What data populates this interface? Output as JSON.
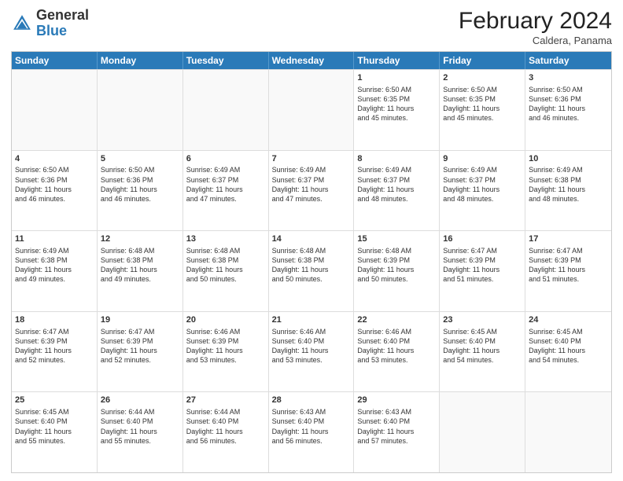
{
  "header": {
    "logo_general": "General",
    "logo_blue": "Blue",
    "month_title": "February 2024",
    "subtitle": "Caldera, Panama"
  },
  "days_of_week": [
    "Sunday",
    "Monday",
    "Tuesday",
    "Wednesday",
    "Thursday",
    "Friday",
    "Saturday"
  ],
  "weeks": [
    [
      {
        "day": "",
        "lines": [],
        "empty": true
      },
      {
        "day": "",
        "lines": [],
        "empty": true
      },
      {
        "day": "",
        "lines": [],
        "empty": true
      },
      {
        "day": "",
        "lines": [],
        "empty": true
      },
      {
        "day": "1",
        "lines": [
          "Sunrise: 6:50 AM",
          "Sunset: 6:35 PM",
          "Daylight: 11 hours",
          "and 45 minutes."
        ],
        "empty": false
      },
      {
        "day": "2",
        "lines": [
          "Sunrise: 6:50 AM",
          "Sunset: 6:35 PM",
          "Daylight: 11 hours",
          "and 45 minutes."
        ],
        "empty": false
      },
      {
        "day": "3",
        "lines": [
          "Sunrise: 6:50 AM",
          "Sunset: 6:36 PM",
          "Daylight: 11 hours",
          "and 46 minutes."
        ],
        "empty": false
      }
    ],
    [
      {
        "day": "4",
        "lines": [
          "Sunrise: 6:50 AM",
          "Sunset: 6:36 PM",
          "Daylight: 11 hours",
          "and 46 minutes."
        ],
        "empty": false
      },
      {
        "day": "5",
        "lines": [
          "Sunrise: 6:50 AM",
          "Sunset: 6:36 PM",
          "Daylight: 11 hours",
          "and 46 minutes."
        ],
        "empty": false
      },
      {
        "day": "6",
        "lines": [
          "Sunrise: 6:49 AM",
          "Sunset: 6:37 PM",
          "Daylight: 11 hours",
          "and 47 minutes."
        ],
        "empty": false
      },
      {
        "day": "7",
        "lines": [
          "Sunrise: 6:49 AM",
          "Sunset: 6:37 PM",
          "Daylight: 11 hours",
          "and 47 minutes."
        ],
        "empty": false
      },
      {
        "day": "8",
        "lines": [
          "Sunrise: 6:49 AM",
          "Sunset: 6:37 PM",
          "Daylight: 11 hours",
          "and 48 minutes."
        ],
        "empty": false
      },
      {
        "day": "9",
        "lines": [
          "Sunrise: 6:49 AM",
          "Sunset: 6:37 PM",
          "Daylight: 11 hours",
          "and 48 minutes."
        ],
        "empty": false
      },
      {
        "day": "10",
        "lines": [
          "Sunrise: 6:49 AM",
          "Sunset: 6:38 PM",
          "Daylight: 11 hours",
          "and 48 minutes."
        ],
        "empty": false
      }
    ],
    [
      {
        "day": "11",
        "lines": [
          "Sunrise: 6:49 AM",
          "Sunset: 6:38 PM",
          "Daylight: 11 hours",
          "and 49 minutes."
        ],
        "empty": false
      },
      {
        "day": "12",
        "lines": [
          "Sunrise: 6:48 AM",
          "Sunset: 6:38 PM",
          "Daylight: 11 hours",
          "and 49 minutes."
        ],
        "empty": false
      },
      {
        "day": "13",
        "lines": [
          "Sunrise: 6:48 AM",
          "Sunset: 6:38 PM",
          "Daylight: 11 hours",
          "and 50 minutes."
        ],
        "empty": false
      },
      {
        "day": "14",
        "lines": [
          "Sunrise: 6:48 AM",
          "Sunset: 6:38 PM",
          "Daylight: 11 hours",
          "and 50 minutes."
        ],
        "empty": false
      },
      {
        "day": "15",
        "lines": [
          "Sunrise: 6:48 AM",
          "Sunset: 6:39 PM",
          "Daylight: 11 hours",
          "and 50 minutes."
        ],
        "empty": false
      },
      {
        "day": "16",
        "lines": [
          "Sunrise: 6:47 AM",
          "Sunset: 6:39 PM",
          "Daylight: 11 hours",
          "and 51 minutes."
        ],
        "empty": false
      },
      {
        "day": "17",
        "lines": [
          "Sunrise: 6:47 AM",
          "Sunset: 6:39 PM",
          "Daylight: 11 hours",
          "and 51 minutes."
        ],
        "empty": false
      }
    ],
    [
      {
        "day": "18",
        "lines": [
          "Sunrise: 6:47 AM",
          "Sunset: 6:39 PM",
          "Daylight: 11 hours",
          "and 52 minutes."
        ],
        "empty": false
      },
      {
        "day": "19",
        "lines": [
          "Sunrise: 6:47 AM",
          "Sunset: 6:39 PM",
          "Daylight: 11 hours",
          "and 52 minutes."
        ],
        "empty": false
      },
      {
        "day": "20",
        "lines": [
          "Sunrise: 6:46 AM",
          "Sunset: 6:39 PM",
          "Daylight: 11 hours",
          "and 53 minutes."
        ],
        "empty": false
      },
      {
        "day": "21",
        "lines": [
          "Sunrise: 6:46 AM",
          "Sunset: 6:40 PM",
          "Daylight: 11 hours",
          "and 53 minutes."
        ],
        "empty": false
      },
      {
        "day": "22",
        "lines": [
          "Sunrise: 6:46 AM",
          "Sunset: 6:40 PM",
          "Daylight: 11 hours",
          "and 53 minutes."
        ],
        "empty": false
      },
      {
        "day": "23",
        "lines": [
          "Sunrise: 6:45 AM",
          "Sunset: 6:40 PM",
          "Daylight: 11 hours",
          "and 54 minutes."
        ],
        "empty": false
      },
      {
        "day": "24",
        "lines": [
          "Sunrise: 6:45 AM",
          "Sunset: 6:40 PM",
          "Daylight: 11 hours",
          "and 54 minutes."
        ],
        "empty": false
      }
    ],
    [
      {
        "day": "25",
        "lines": [
          "Sunrise: 6:45 AM",
          "Sunset: 6:40 PM",
          "Daylight: 11 hours",
          "and 55 minutes."
        ],
        "empty": false
      },
      {
        "day": "26",
        "lines": [
          "Sunrise: 6:44 AM",
          "Sunset: 6:40 PM",
          "Daylight: 11 hours",
          "and 55 minutes."
        ],
        "empty": false
      },
      {
        "day": "27",
        "lines": [
          "Sunrise: 6:44 AM",
          "Sunset: 6:40 PM",
          "Daylight: 11 hours",
          "and 56 minutes."
        ],
        "empty": false
      },
      {
        "day": "28",
        "lines": [
          "Sunrise: 6:43 AM",
          "Sunset: 6:40 PM",
          "Daylight: 11 hours",
          "and 56 minutes."
        ],
        "empty": false
      },
      {
        "day": "29",
        "lines": [
          "Sunrise: 6:43 AM",
          "Sunset: 6:40 PM",
          "Daylight: 11 hours",
          "and 57 minutes."
        ],
        "empty": false
      },
      {
        "day": "",
        "lines": [],
        "empty": true
      },
      {
        "day": "",
        "lines": [],
        "empty": true
      }
    ]
  ]
}
